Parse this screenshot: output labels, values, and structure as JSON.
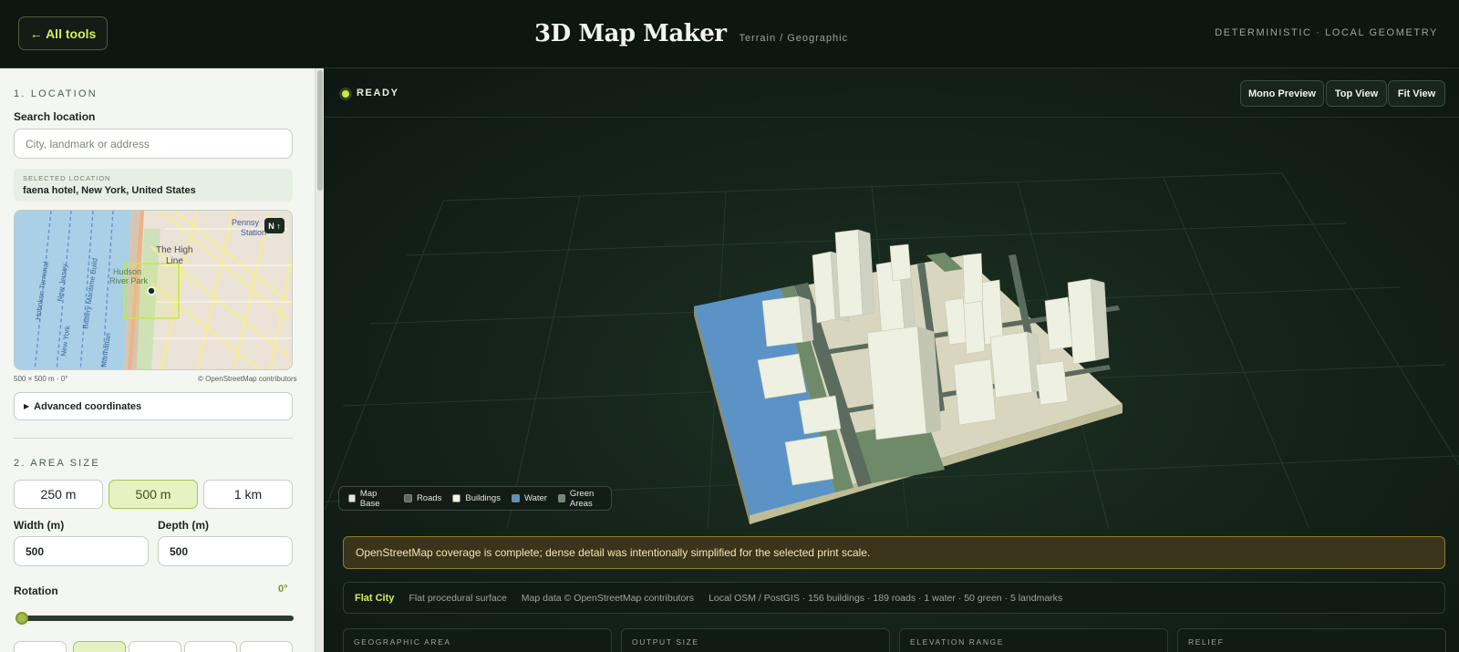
{
  "header": {
    "back_label": "← All tools",
    "title": "3D Map Maker",
    "subtitle": "Terrain / Geographic",
    "tag": "DETERMINISTIC · LOCAL GEOMETRY"
  },
  "sidebar": {
    "location": {
      "section_title": "1. LOCATION",
      "search_label": "Search location",
      "search_placeholder": "City, landmark or address",
      "selected_caption": "SELECTED LOCATION",
      "selected_value": "faena hotel, New York, United States",
      "map_labels": {
        "high_line": "The High",
        "high_line_2": "Line",
        "hudson": "Hudson",
        "river_park": "River Park",
        "penn": "Pennsy",
        "station": "Station",
        "hoboken": "Hoboken Terminal",
        "new_jersey": "New Jersey",
        "battery": "Battery Maritime Build",
        "manhattan": "Manhattan",
        "new_york": "New York"
      },
      "compass": "N ↑",
      "map_caption": "500 × 500 m · 0°",
      "map_attribution": "© OpenStreetMap contributors",
      "advanced_label": "Advanced coordinates"
    },
    "area": {
      "section_title": "2. AREA SIZE",
      "presets": [
        "250 m",
        "500 m",
        "1 km"
      ],
      "width_label": "Width (m)",
      "width_value": "500",
      "depth_label": "Depth (m)",
      "depth_value": "500",
      "rotation_label": "Rotation",
      "rotation_value": "0°",
      "rotation_fraction": 0.0
    }
  },
  "viewport": {
    "status": "READY",
    "buttons": {
      "mono_preview": "Mono Preview",
      "top_view": "Top View",
      "fit_view": "Fit View"
    },
    "legend": [
      {
        "label": "Map Base",
        "color": "#e8e6d8"
      },
      {
        "label": "Roads",
        "color": "#5b6b5e"
      },
      {
        "label": "Buildings",
        "color": "#f3f3e6"
      },
      {
        "label": "Water",
        "color": "#5b93c6"
      },
      {
        "label": "Green Areas",
        "color": "#6f8a68"
      }
    ],
    "warning": "OpenStreetMap coverage is complete; dense detail was intentionally simplified for the selected print scale.",
    "info": {
      "mode": "Flat City",
      "surface": "Flat procedural surface",
      "attribution": "Map data © OpenStreetMap contributors",
      "stats": "Local OSM / PostGIS · 156 buildings · 189 roads · 1 water · 50 green · 5 landmarks"
    },
    "cards": [
      "GEOGRAPHIC AREA",
      "OUTPUT SIZE",
      "ELEVATION RANGE",
      "RELIEF"
    ]
  },
  "colors": {
    "accent": "#d7ee5a",
    "water": "#5b93c6",
    "buildings": "#eef0e2",
    "base": "#d9d6bf"
  }
}
